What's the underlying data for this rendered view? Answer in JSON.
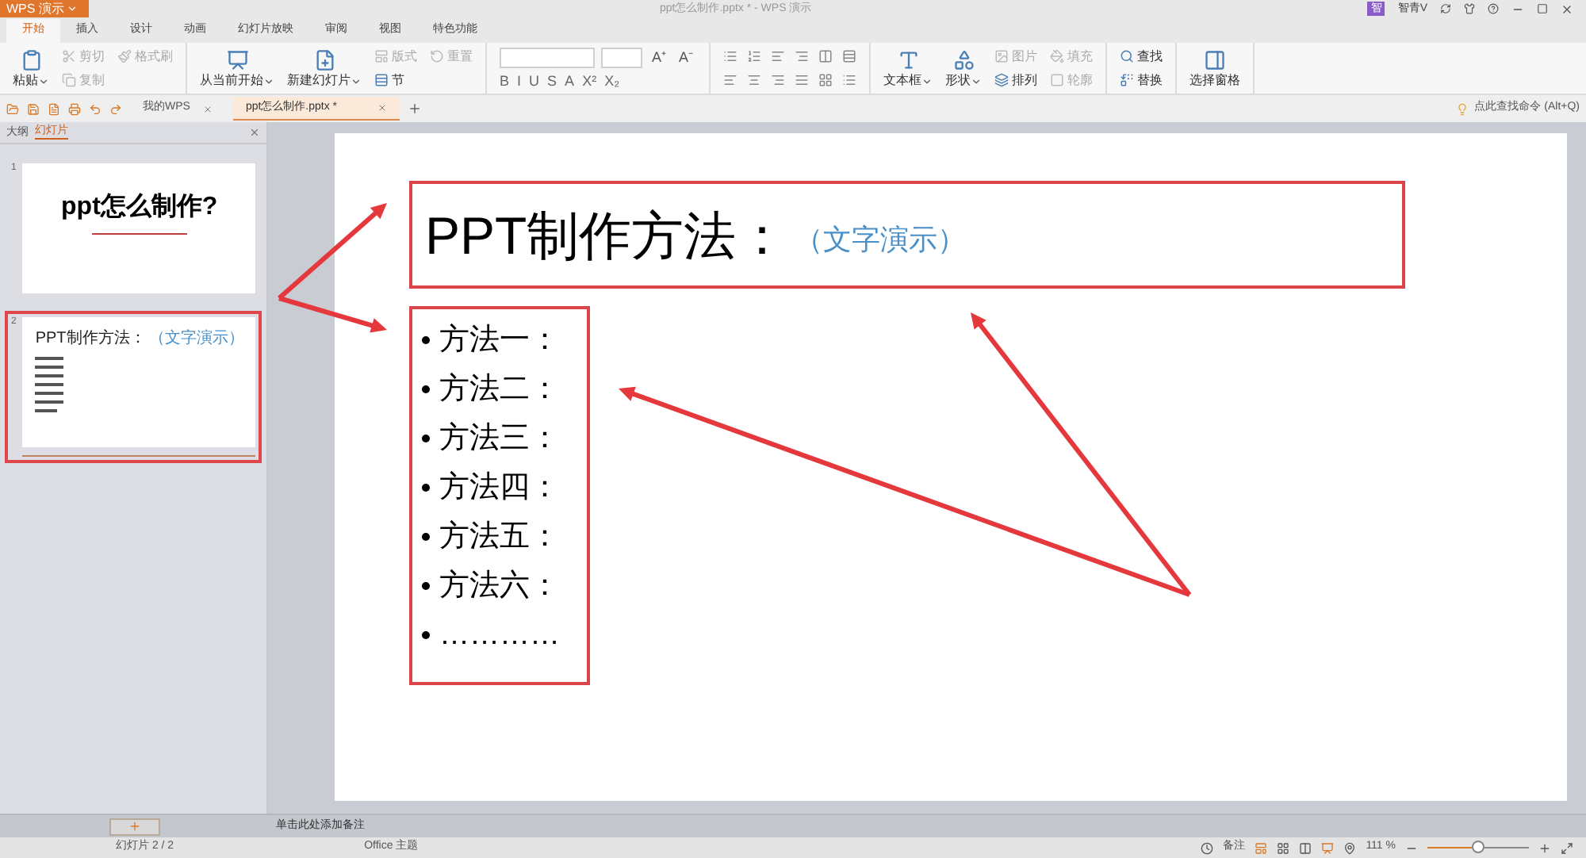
{
  "app": {
    "name": "WPS 演示",
    "document_title": "ppt怎么制作.pptx * - WPS 演示",
    "account": "智青V",
    "badge": "智"
  },
  "menu_tabs": [
    {
      "label": "开始",
      "selected": true
    },
    {
      "label": "插入",
      "selected": false
    },
    {
      "label": "设计",
      "selected": false
    },
    {
      "label": "动画",
      "selected": false
    },
    {
      "label": "幻灯片放映",
      "selected": false
    },
    {
      "label": "审阅",
      "selected": false
    },
    {
      "label": "视图",
      "selected": false
    },
    {
      "label": "特色功能",
      "selected": false
    }
  ],
  "ribbon": [
    {
      "kind": "buttons",
      "large": [
        {
          "label": "粘贴",
          "dropdown": true
        }
      ],
      "small": [
        {
          "label": "剪切",
          "disabled": true
        },
        {
          "label": "复制",
          "disabled": true
        },
        {
          "label": "格式刷",
          "disabled": true
        }
      ]
    },
    {
      "kind": "buttons",
      "large": [
        {
          "label": "从当前开始",
          "dropdown": true
        },
        {
          "label": "新建幻灯片",
          "dropdown": true
        }
      ],
      "small": [
        {
          "label": "版式",
          "disabled": true
        },
        {
          "label": "节",
          "disabled": false
        },
        {
          "label": "重置",
          "disabled": true
        }
      ]
    },
    {
      "kind": "font",
      "top": [
        "A⁺",
        "A⁻"
      ],
      "bottom": [
        "B",
        "I",
        "U",
        "S",
        "A",
        "X²",
        "X₂"
      ]
    },
    {
      "kind": "paragraph"
    },
    {
      "kind": "buttons",
      "large": [
        {
          "label": "文本框",
          "dropdown": true
        },
        {
          "label": "形状",
          "dropdown": true
        }
      ],
      "small": [
        {
          "label": "图片",
          "disabled": true
        },
        {
          "label": "排列",
          "disabled": false
        },
        {
          "label": "填充",
          "disabled": true
        },
        {
          "label": "轮廓",
          "disabled": true
        }
      ]
    },
    {
      "kind": "buttons",
      "small": [
        {
          "label": "查找",
          "disabled": false
        },
        {
          "label": "替换",
          "disabled": false
        }
      ]
    },
    {
      "kind": "buttons",
      "large": [
        {
          "label": "选择窗格",
          "dropdown": false
        }
      ]
    }
  ],
  "doc_tabs": [
    {
      "label": "我的WPS",
      "selected": false
    },
    {
      "label": "ppt怎么制作.pptx *",
      "selected": true
    }
  ],
  "command_search": "点此查找命令 (Alt+Q)",
  "panel": {
    "tabs": [
      {
        "label": "大纲",
        "selected": false
      },
      {
        "label": "幻灯片",
        "selected": true
      }
    ],
    "slides": [
      {
        "number": "1",
        "selected": false,
        "title": "ppt怎么制作?"
      },
      {
        "number": "2",
        "selected": true,
        "title": "PPT制作方法：",
        "subtitle": "（文字演示）"
      }
    ]
  },
  "slide": {
    "title": "PPT制作方法：",
    "subtitle": "（文字演示）",
    "bullets": [
      "方法一：",
      "方法二：",
      "方法三：",
      "方法四：",
      "方法五：",
      "方法六：",
      "…………"
    ]
  },
  "notes_placeholder": "单击此处添加备注",
  "status_bar": {
    "slide_counter": "幻灯片 2 / 2",
    "theme": "Office 主题",
    "notes": "备注",
    "zoom": "111 %",
    "zoom_slider": {
      "level": 0.5
    }
  }
}
